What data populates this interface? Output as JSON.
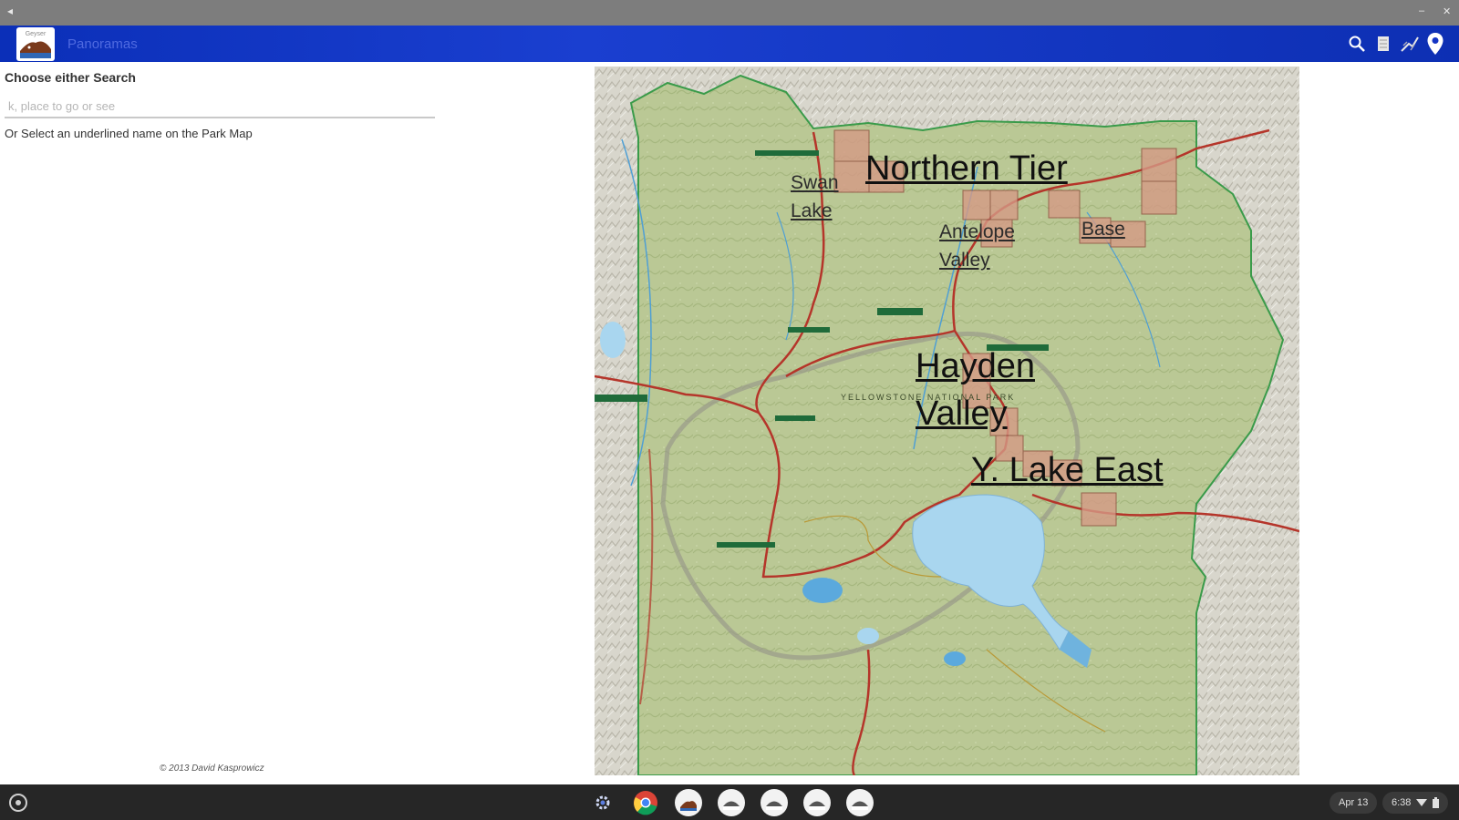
{
  "window": {
    "back_glyph": "◂",
    "minimize_glyph": "–",
    "close_glyph": "✕"
  },
  "appbar": {
    "title": "Panoramas",
    "logo_text": "Geyser",
    "actions": [
      {
        "name": "search-icon"
      },
      {
        "name": "list-icon"
      },
      {
        "name": "hike-icon"
      },
      {
        "name": "location-pin-icon"
      }
    ]
  },
  "left": {
    "choose_label": "Choose either Search",
    "search_placeholder": "k, place to go or see",
    "search_value": "",
    "select_hint": "Or Select an underlined name on the Park Map",
    "copyright": "© 2013 David Kasprowicz"
  },
  "map": {
    "labels": {
      "northern_tier": "Northern Tier",
      "swan_lake_1": "Swan",
      "swan_lake_2": "Lake",
      "antelope_valley_1": "Antelope",
      "antelope_valley_2": "Valley",
      "base": "Base",
      "hayden_valley_1": "Hayden",
      "hayden_valley_2": "Valley",
      "y_lake_east": "Y. Lake East"
    },
    "printed": {
      "park_name": "YELLOWSTONE NATIONAL PARK"
    }
  },
  "shelf": {
    "apps": [
      "settings-icon",
      "chrome-icon",
      "panoramas-app-icon",
      "app-icon-1",
      "app-icon-2",
      "app-icon-3",
      "app-icon-4"
    ],
    "date": "Apr 13",
    "time": "6:38"
  },
  "colors": {
    "appbar": "#1434c4",
    "map_green": "#b9c896",
    "lake": "#a9d6ef",
    "shelf": "#262626"
  }
}
